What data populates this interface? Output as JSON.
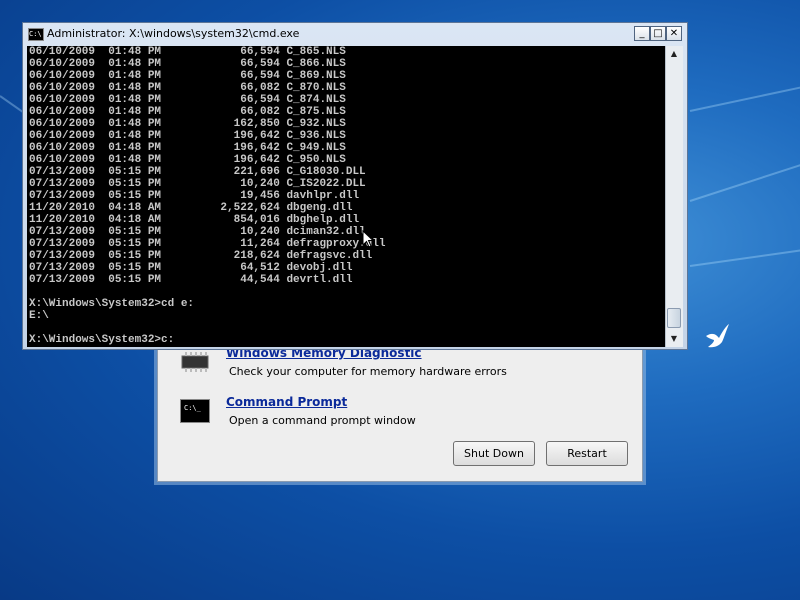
{
  "cmd_window": {
    "title": "Administrator: X:\\windows\\system32\\cmd.exe",
    "icon_text": "C:\\",
    "minimize_glyph": "_",
    "maximize_glyph": "□",
    "close_glyph": "✕",
    "lines": [
      "06/10/2009  01:48 PM            66,594 C_865.NLS",
      "06/10/2009  01:48 PM            66,594 C_866.NLS",
      "06/10/2009  01:48 PM            66,594 C_869.NLS",
      "06/10/2009  01:48 PM            66,082 C_870.NLS",
      "06/10/2009  01:48 PM            66,594 C_874.NLS",
      "06/10/2009  01:48 PM            66,082 C_875.NLS",
      "06/10/2009  01:48 PM           162,850 C_932.NLS",
      "06/10/2009  01:48 PM           196,642 C_936.NLS",
      "06/10/2009  01:48 PM           196,642 C_949.NLS",
      "06/10/2009  01:48 PM           196,642 C_950.NLS",
      "07/13/2009  05:15 PM           221,696 C_G18030.DLL",
      "07/13/2009  05:15 PM            10,240 C_IS2022.DLL",
      "07/13/2009  05:15 PM            19,456 davhlpr.dll",
      "11/20/2010  04:18 AM         2,522,624 dbgeng.dll",
      "11/20/2010  04:18 AM           854,016 dbghelp.dll",
      "07/13/2009  05:15 PM            10,240 dciman32.dll",
      "07/13/2009  05:15 PM            11,264 defragproxy.dll",
      "07/13/2009  05:15 PM           218,624 defragsvc.dll",
      "07/13/2009  05:15 PM            64,512 devobj.dll",
      "07/13/2009  05:15 PM            44,544 devrtl.dll",
      "",
      "X:\\Windows\\System32>cd e:",
      "E:\\",
      "",
      "X:\\Windows\\System32>c:"
    ]
  },
  "recovery_options": {
    "items": [
      {
        "title": "Windows Memory Diagnostic",
        "description": "Check your computer for memory hardware errors",
        "icon": "memory-chip-icon"
      },
      {
        "title": "Command Prompt",
        "description": "Open a command prompt window",
        "icon": "command-prompt-icon"
      }
    ],
    "cmd_icon_text": "C:\\_",
    "shutdown_label": "Shut Down",
    "restart_label": "Restart"
  },
  "colors": {
    "console_bg": "#000000",
    "console_text": "#c8c8c8",
    "link": "#0b2a9a",
    "desktop": "#1f6cc0"
  }
}
